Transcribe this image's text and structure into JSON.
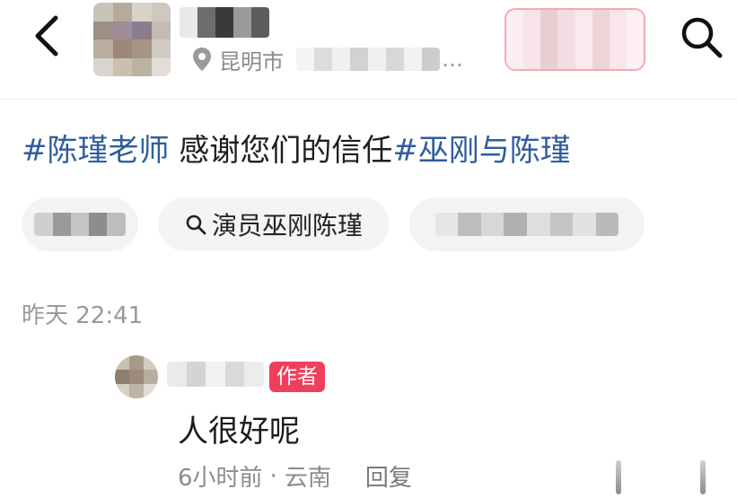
{
  "header": {
    "location_city": "昆明市",
    "location_ellipsis": "…"
  },
  "caption": {
    "tag1": "#陈瑾老师",
    "text": " 感谢您们的信任",
    "tag2": "#巫刚与陈瑾"
  },
  "chips": {
    "search_chip_label": "演员巫刚陈瑾"
  },
  "timestamp": "昨天 22:41",
  "comment": {
    "author_badge": "作者",
    "text": "人很好呢",
    "time": "6小时前",
    "separator": "·",
    "region": "云南",
    "reply_label": "回复"
  },
  "colors": {
    "hashtag": "#2f5d9e",
    "author_badge_bg": "#ef3f5a",
    "follow_border": "#f3a9b1",
    "muted_text": "#9a9a9a"
  },
  "icons": [
    "back-arrow-icon",
    "location-pin-icon",
    "search-icon",
    "search-small-icon"
  ]
}
